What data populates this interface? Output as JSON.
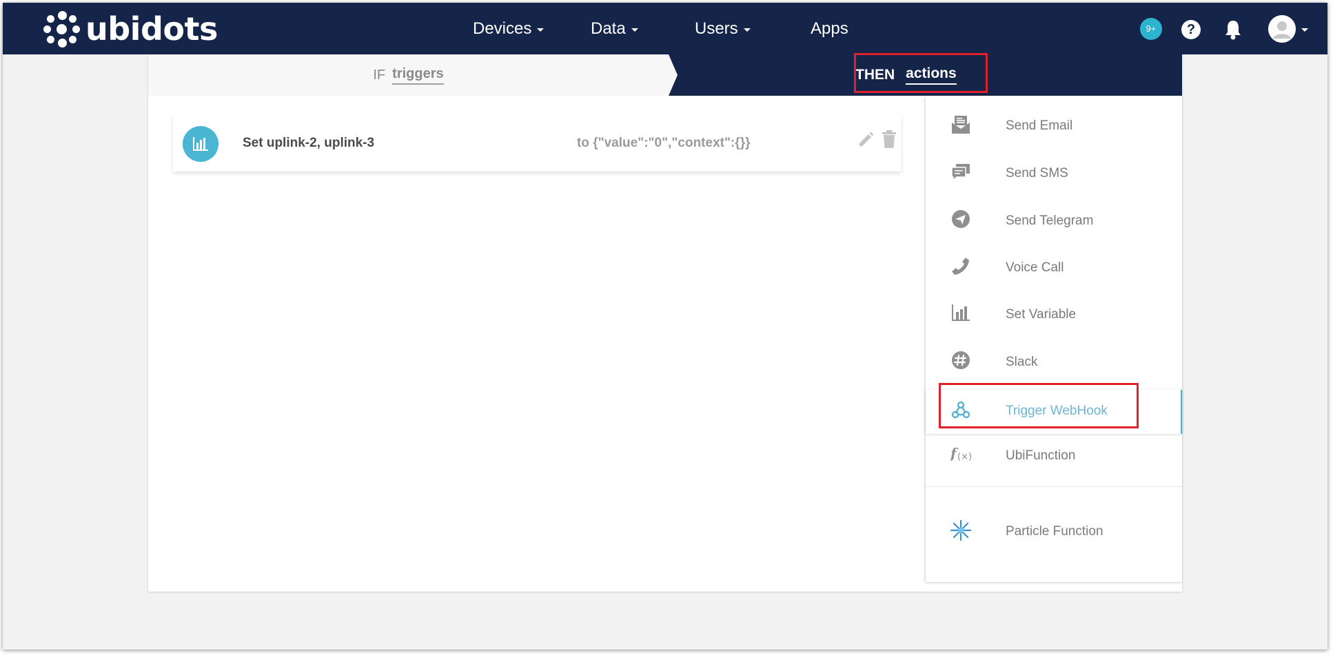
{
  "navbar": {
    "logo_text": "ubidots",
    "menu": [
      {
        "label": "Devices",
        "has_dropdown": true
      },
      {
        "label": "Data",
        "has_dropdown": true
      },
      {
        "label": "Users",
        "has_dropdown": true
      },
      {
        "label": "Apps",
        "has_dropdown": false
      }
    ],
    "notification_badge": "9+",
    "help_label": "?"
  },
  "steps": {
    "if_prefix": "IF",
    "if_word": "triggers",
    "then_prefix": "THEN",
    "then_word": "actions"
  },
  "action_row": {
    "title": "Set uplink-2, uplink-3",
    "value": "to {\"value\":\"0\",\"context\":{}}"
  },
  "actions_menu": {
    "items": [
      {
        "label": "Send Email",
        "icon": "envelope-icon"
      },
      {
        "label": "Send SMS",
        "icon": "chat-icon"
      },
      {
        "label": "Send Telegram",
        "icon": "telegram-icon"
      },
      {
        "label": "Voice Call",
        "icon": "phone-icon"
      },
      {
        "label": "Set Variable",
        "icon": "bar-chart-icon"
      },
      {
        "label": "Slack",
        "icon": "slack-icon"
      },
      {
        "label": "Trigger WebHook",
        "icon": "webhook-icon",
        "active": true
      },
      {
        "label": "UbiFunction",
        "icon": "function-icon"
      },
      {
        "label": "Particle Function",
        "icon": "particle-icon"
      }
    ]
  },
  "colors": {
    "navbar": "#15254a",
    "accent": "#4bb5d4",
    "highlight": "#e0202b"
  }
}
